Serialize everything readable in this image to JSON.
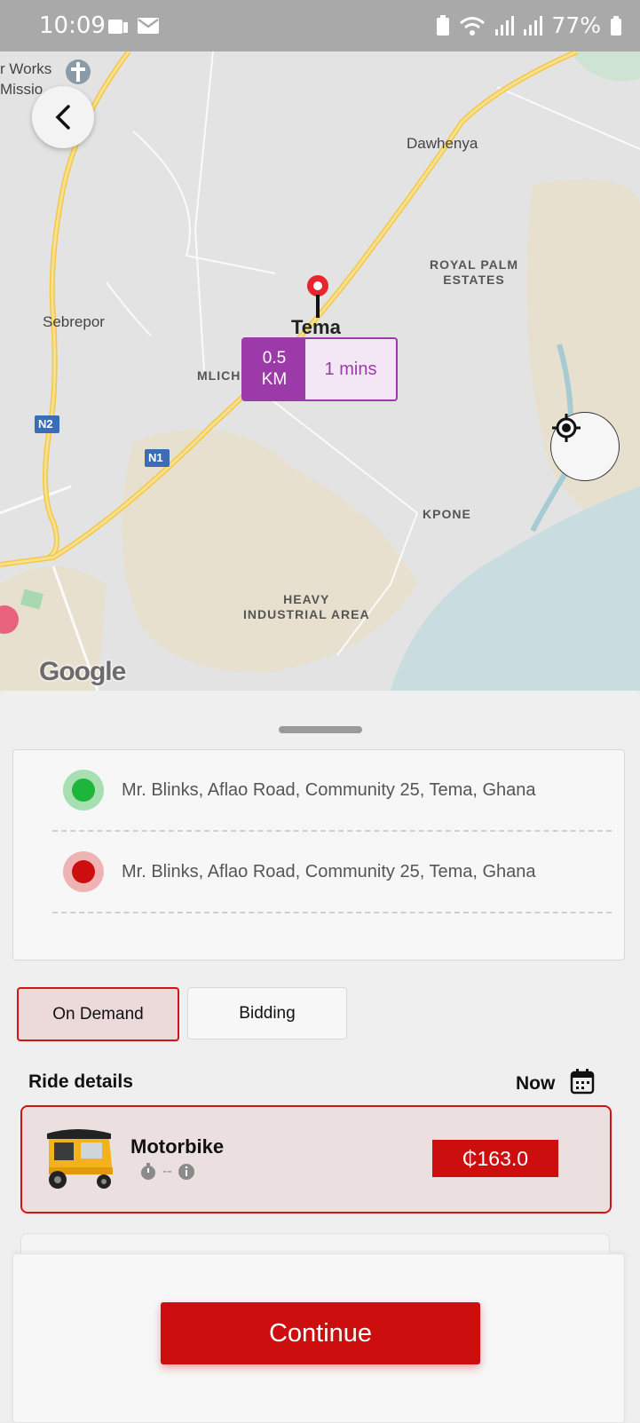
{
  "status_bar": {
    "time": "10:09",
    "battery": "77%"
  },
  "map": {
    "labels": {
      "works": "r Works",
      "mission": "Missio",
      "dawhenya": "Dawhenya",
      "royal_palm": "ROYAL PALM\nESTATES",
      "sebrepor": "Sebrepor",
      "mlichakpo": "MLICHAKPO",
      "kpone": "KPONE",
      "heavy_industrial": "HEAVY\nINDUSTRIAL AREA",
      "n1": "N1",
      "n2": "N2",
      "destination": "Tema"
    },
    "route": {
      "distance_value": "0.5",
      "distance_unit": "KM",
      "duration": "1 mins"
    },
    "attribution": "Google"
  },
  "addresses": {
    "pickup": "Mr. Blinks, Aflao Road, Community 25, Tema, Ghana",
    "dropoff": "Mr. Blinks, Aflao Road, Community 25, Tema, Ghana"
  },
  "mode_tabs": [
    {
      "label": "On Demand",
      "selected": true
    },
    {
      "label": "Bidding",
      "selected": false
    }
  ],
  "ride_details": {
    "title": "Ride details",
    "schedule": "Now",
    "vehicle": {
      "name": "Motorbike",
      "eta": "--",
      "price": "₵163.0"
    }
  },
  "continue_label": "Continue",
  "colors": {
    "accent": "#cc0e0e",
    "route_purple": "#9b3aa8",
    "pickup": "#1db53a",
    "dropoff": "#cc0e0e"
  }
}
